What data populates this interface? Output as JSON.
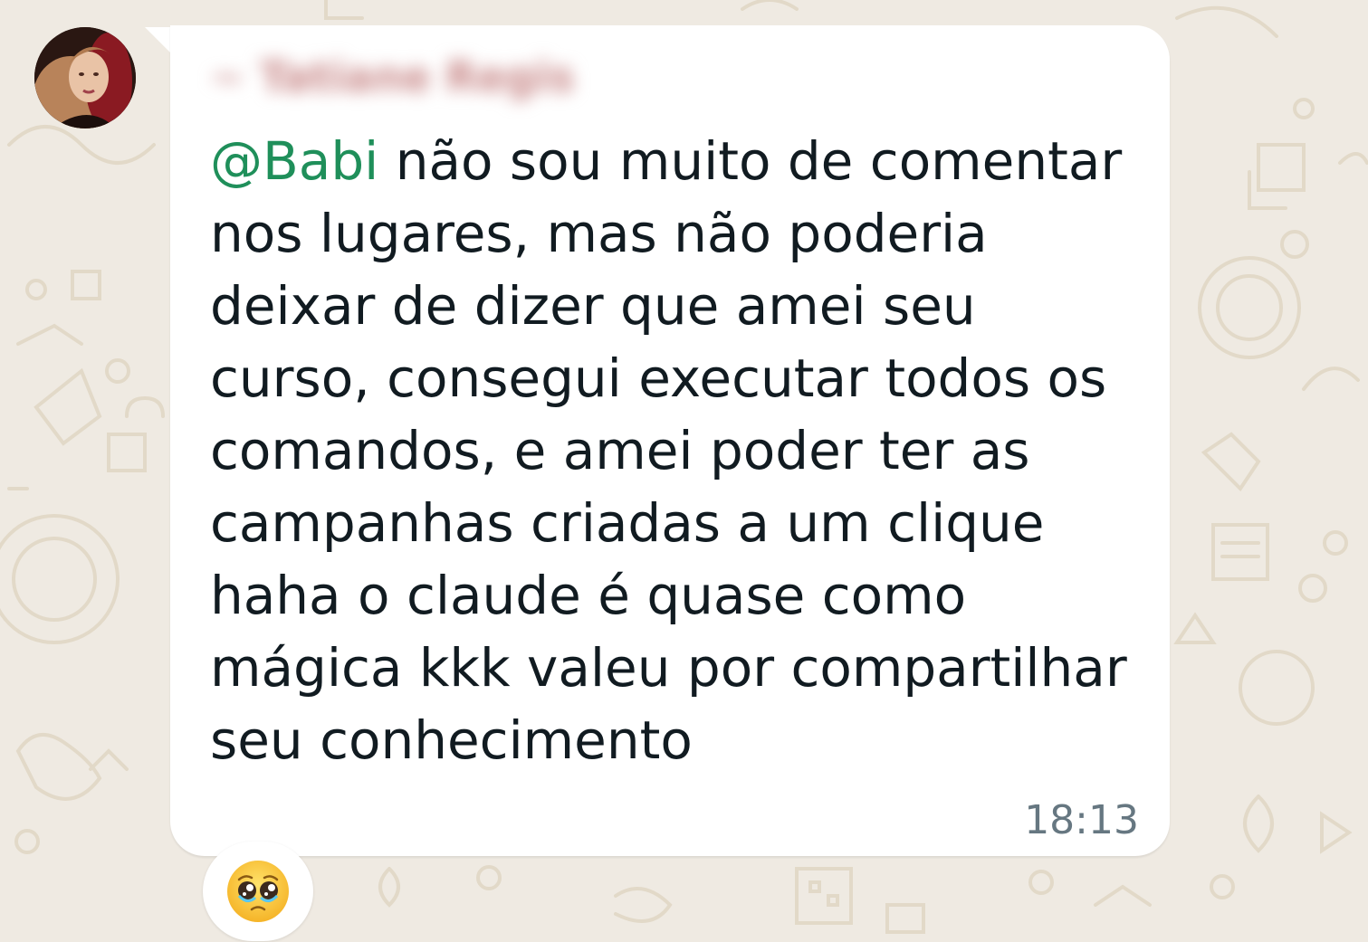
{
  "message": {
    "sender_name": "~ Tatiane Regis",
    "mention": "@Babi",
    "body": "não sou muito de comentar nos lugares, mas não poderia deixar de dizer que amei seu curso, consegui executar todos os comandos, e amei poder ter as campanhas criadas a um clique haha o claude é quase como mágica kkk valeu por compartilhar seu conhecimento",
    "time": "18:13",
    "reaction_icon": "pleading-face-emoji"
  },
  "colors": {
    "wallpaper": "#efeae2",
    "bubble": "#ffffff",
    "mention": "#1f8f5a",
    "text": "#111b21",
    "time": "#667781"
  }
}
